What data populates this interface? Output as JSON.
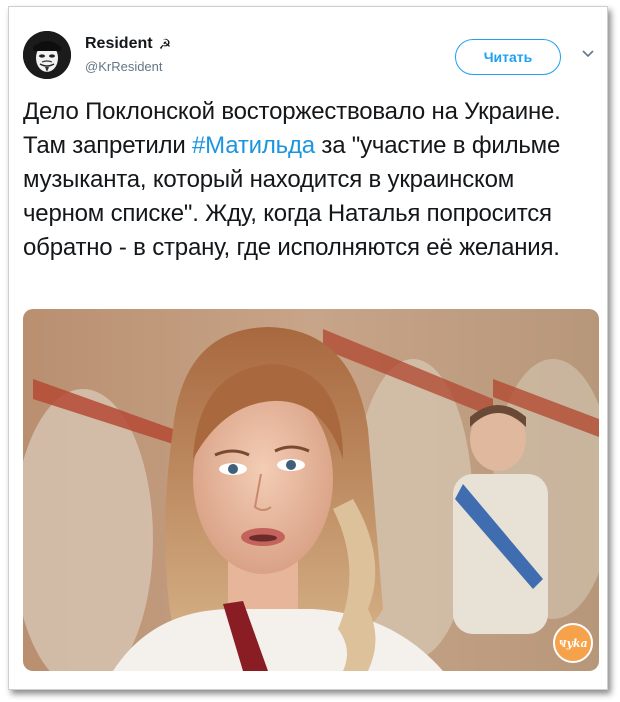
{
  "tweet": {
    "author_name": "Resident",
    "author_emoji": "☭",
    "handle": "@KrResident",
    "follow_label": "Читать",
    "text_before": "Дело Поклонской восторжествовало на Украине. Там запретили ",
    "hashtag": "#Матильда",
    "text_after": " за \"участие в фильме музыканта, который находится в украинском черном списке\". Жду, когда Наталья попросится обратно - в страну, где исполняются её желания."
  },
  "icons": {
    "avatar": "guy-fawkes-mask-avatar",
    "more": "chevron-down-icon"
  },
  "watermark": "Ҹyka",
  "colors": {
    "accent": "#1da1f2",
    "hashtag": "#1b95e0",
    "text": "#14171a",
    "muted": "#657786"
  }
}
